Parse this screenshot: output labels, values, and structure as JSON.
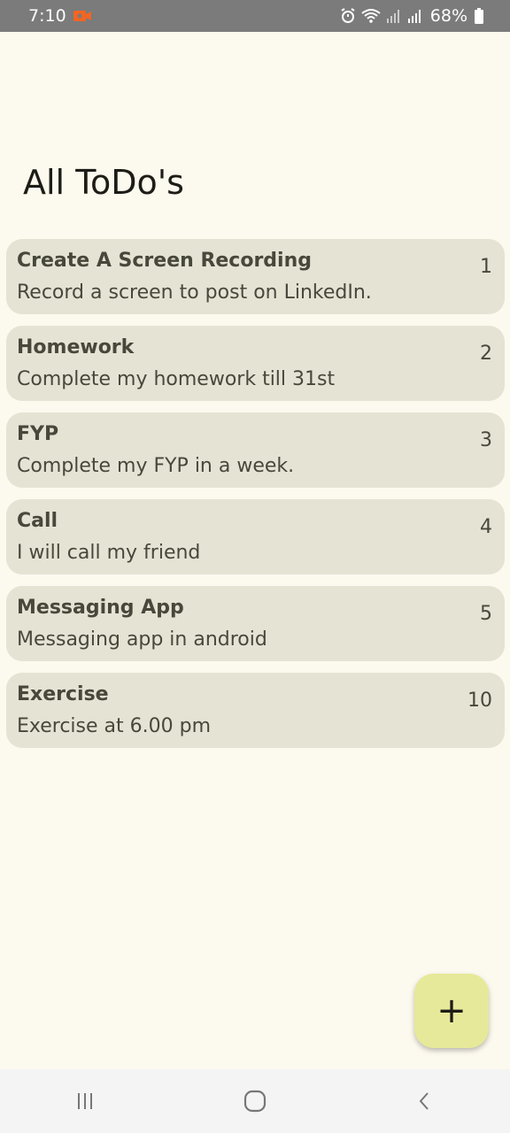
{
  "status_bar": {
    "time": "7:10",
    "battery": "68%",
    "icons": [
      "screen-record-icon",
      "alarm-icon",
      "wifi-icon",
      "signal-icon",
      "signal-icon",
      "battery-icon"
    ]
  },
  "page": {
    "title": "All ToDo's"
  },
  "todos": [
    {
      "title": "Create A Screen Recording",
      "description": "Record a screen to post on LinkedIn.",
      "number": "1"
    },
    {
      "title": "Homework",
      "description": "Complete my homework till 31st",
      "number": "2"
    },
    {
      "title": "FYP",
      "description": "Complete my FYP in a week.",
      "number": "3"
    },
    {
      "title": "Call",
      "description": "I will call my friend",
      "number": "4"
    },
    {
      "title": "Messaging App",
      "description": "Messaging app in android",
      "number": "5"
    },
    {
      "title": "Exercise",
      "description": "Exercise at 6.00 pm",
      "number": "10"
    }
  ],
  "fab": {
    "icon": "plus-icon",
    "label": "+"
  },
  "nav_bar": {
    "buttons": [
      "recent-apps-icon",
      "home-icon",
      "back-icon"
    ]
  },
  "colors": {
    "background": "#fcf9ee",
    "card": "#e5e3d3",
    "fab": "#e6e999",
    "status_bar": "#7b7b7b",
    "record_accent": "#f26522"
  }
}
